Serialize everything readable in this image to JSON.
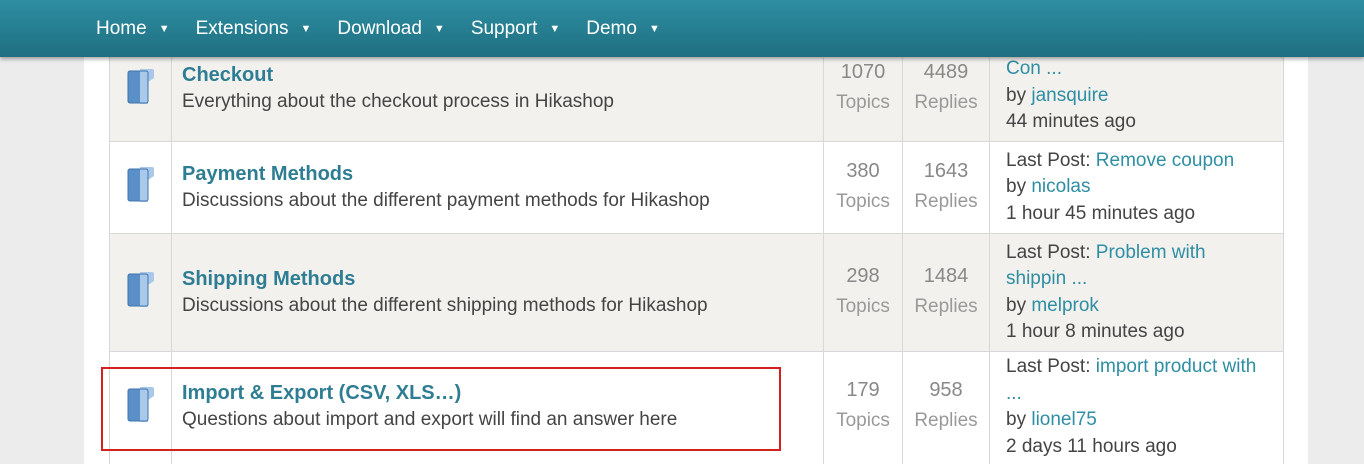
{
  "nav": {
    "items": [
      {
        "label": "Home"
      },
      {
        "label": "Extensions"
      },
      {
        "label": "Download"
      },
      {
        "label": "Support"
      },
      {
        "label": "Demo"
      }
    ],
    "caret": "▼"
  },
  "colors": {
    "nav_bar": "#267d90",
    "link": "#2e7d93",
    "highlight_border": "#d42020"
  },
  "forums": [
    {
      "title": "Checkout",
      "description": "Everything about the checkout process in Hikashop",
      "topics": "1070",
      "topics_label": "Topics",
      "replies": "4489",
      "replies_label": "Replies",
      "last_post_prefix": "",
      "last_post_title": "Con ...",
      "last_post_title_2": "",
      "by_prefix": "by ",
      "author": "jansquire",
      "time": "44 minutes ago"
    },
    {
      "title": "Payment Methods",
      "description": "Discussions about the different payment methods for Hikashop",
      "topics": "380",
      "topics_label": "Topics",
      "replies": "1643",
      "replies_label": "Replies",
      "last_post_prefix": "Last Post: ",
      "last_post_title": "Remove coupon",
      "last_post_title_2": "",
      "by_prefix": "by ",
      "author": "nicolas",
      "time": "1 hour 45 minutes ago"
    },
    {
      "title": "Shipping Methods",
      "description": "Discussions about the different shipping methods for Hikashop",
      "topics": "298",
      "topics_label": "Topics",
      "replies": "1484",
      "replies_label": "Replies",
      "last_post_prefix": "Last Post: ",
      "last_post_title": "Problem with",
      "last_post_title_2": "shippin ...",
      "by_prefix": "by ",
      "author": "melprok",
      "time": "1 hour 8 minutes ago"
    },
    {
      "title": "Import & Export (CSV, XLS…)",
      "description": "Questions about import and export will find an answer here",
      "topics": "179",
      "topics_label": "Topics",
      "replies": "958",
      "replies_label": "Replies",
      "last_post_prefix": "Last Post: ",
      "last_post_title": "import product with",
      "last_post_title_2": "...",
      "by_prefix": "by ",
      "author": "lionel75",
      "time": "2 days 11 hours ago"
    }
  ]
}
